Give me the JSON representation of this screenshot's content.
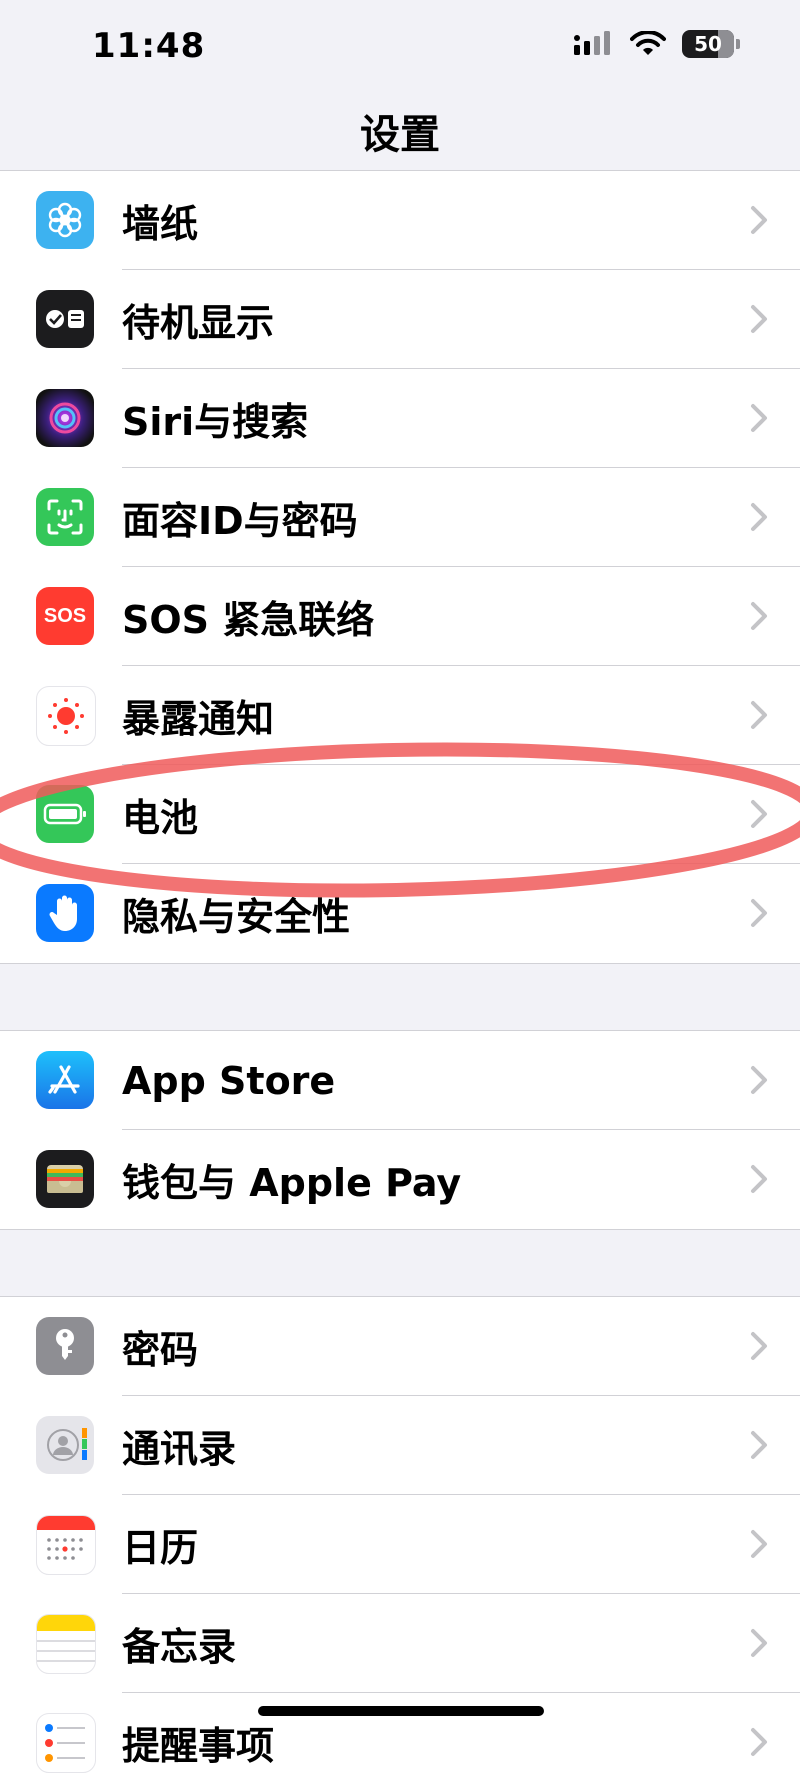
{
  "status_bar": {
    "time": "11:48",
    "battery": "50"
  },
  "nav": {
    "title": "设置"
  },
  "groups": [
    {
      "items": [
        {
          "label": "墙纸",
          "icon": "wallpaper-icon",
          "color": "#3db2f0"
        },
        {
          "label": "待机显示",
          "icon": "standby-icon",
          "color": "#1c1c1e"
        },
        {
          "label": "Siri与搜索",
          "icon": "siri-icon",
          "color": "#1b1b3a"
        },
        {
          "label": "面容ID与密码",
          "icon": "face-id-icon",
          "color": "#34c759"
        },
        {
          "label": "SOS 紧急联络",
          "icon": "sos-icon",
          "color": "#ff3b30",
          "icon_text": "SOS"
        },
        {
          "label": "暴露通知",
          "icon": "exposure-icon",
          "color": "#ffffff"
        },
        {
          "label": "电池",
          "icon": "battery-icon",
          "color": "#34c759"
        },
        {
          "label": "隐私与安全性",
          "icon": "hand-icon",
          "color": "#0a7aff"
        }
      ]
    },
    {
      "items": [
        {
          "label": "App Store",
          "icon": "app-store-icon",
          "color": "#1e8bf4"
        },
        {
          "label": "钱包与 Apple Pay",
          "icon": "wallet-icon",
          "color": "#1c1c1e"
        }
      ]
    },
    {
      "items": [
        {
          "label": "密码",
          "icon": "key-icon",
          "color": "#8e8e93"
        },
        {
          "label": "通讯录",
          "icon": "contacts-icon",
          "color": "#e5e5ea"
        },
        {
          "label": "日历",
          "icon": "calendar-icon",
          "color": "#ffffff"
        },
        {
          "label": "备忘录",
          "icon": "notes-icon",
          "color": "#ffd60a"
        },
        {
          "label": "提醒事项",
          "icon": "reminders-icon",
          "color": "#ffffff"
        }
      ]
    }
  ],
  "annotation": {
    "highlight_color": "#f05a5a"
  }
}
